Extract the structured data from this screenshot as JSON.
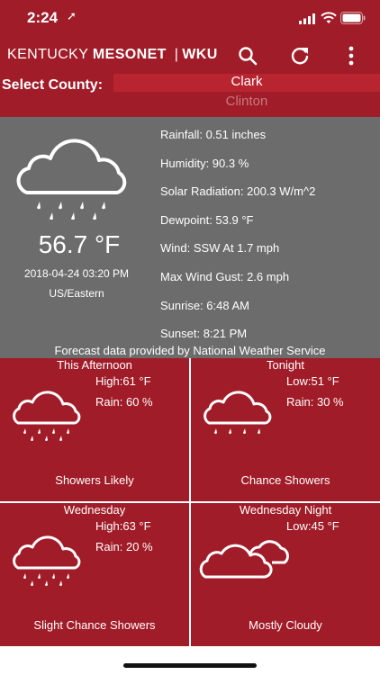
{
  "status_bar": {
    "time": "2:24",
    "location_arrow": "➚"
  },
  "app_bar": {
    "brand_kentucky": "KENTUCKY",
    "brand_mesonet": "MESONET",
    "brand_sep": "|",
    "brand_wku": "WKU",
    "search_icon": "search-icon",
    "refresh_icon": "refresh-icon",
    "menu_icon": "more-vert-icon"
  },
  "county": {
    "label": "Select County:",
    "selected": "Clark",
    "next_option": "Clinton"
  },
  "current": {
    "temperature": "56.7 °F",
    "datetime": "2018-04-24 03:20 PM",
    "timezone": "US/Eastern",
    "icon": "rain-cloud-icon",
    "stats": [
      "Rainfall: 0.51 inches",
      "Humidity: 90.3 %",
      "Solar Radiation: 200.3 W/m^2",
      "Dewpoint: 53.9 °F",
      "Wind: SSW At 1.7 mph",
      "Max Wind Gust: 2.6 mph",
      "Sunrise: 6:48 AM",
      "Sunset: 8:21 PM"
    ],
    "forecast_credit": "Forecast data provided by National Weather Service"
  },
  "forecast": [
    {
      "period": "This Afternoon",
      "hilo": "High:61 °F",
      "rain": "Rain: 60 %",
      "desc": "Showers Likely",
      "icon": "rain-cloud-icon"
    },
    {
      "period": "Tonight",
      "hilo": "Low:51 °F",
      "rain": "Rain: 30 %",
      "desc": "Chance Showers",
      "icon": "rain-cloud-icon"
    },
    {
      "period": "Wednesday",
      "hilo": "High:63 °F",
      "rain": "Rain: 20 %",
      "desc": "Slight Chance Showers",
      "icon": "rain-cloud-icon"
    },
    {
      "period": "Wednesday Night",
      "hilo": "Low:45 °F",
      "rain": "",
      "desc": "Mostly Cloudy",
      "icon": "clouds-icon"
    }
  ],
  "colors": {
    "brand_red": "#a01c28",
    "panel_gray": "#6c6c6c"
  }
}
